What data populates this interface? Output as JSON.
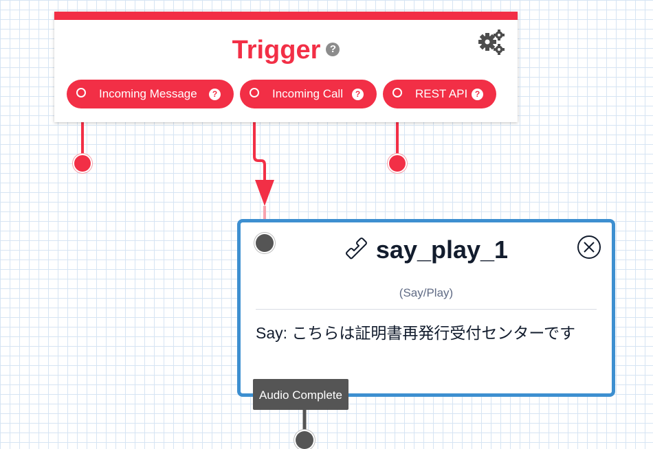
{
  "trigger": {
    "title": "Trigger",
    "help_glyph": "?",
    "settings_icon": "gears-icon",
    "accent_color": "#f22f46",
    "transitions": [
      {
        "label": "Incoming Message"
      },
      {
        "label": "Incoming Call"
      },
      {
        "label": "REST API"
      }
    ]
  },
  "widget": {
    "name": "say_play_1",
    "type": "(Say/Play)",
    "body": "Say: こちらは証明書再発行受付センターです",
    "icon": "phone-icon",
    "border_color": "#3d8fd0",
    "transition_label": "Audio Complete"
  }
}
